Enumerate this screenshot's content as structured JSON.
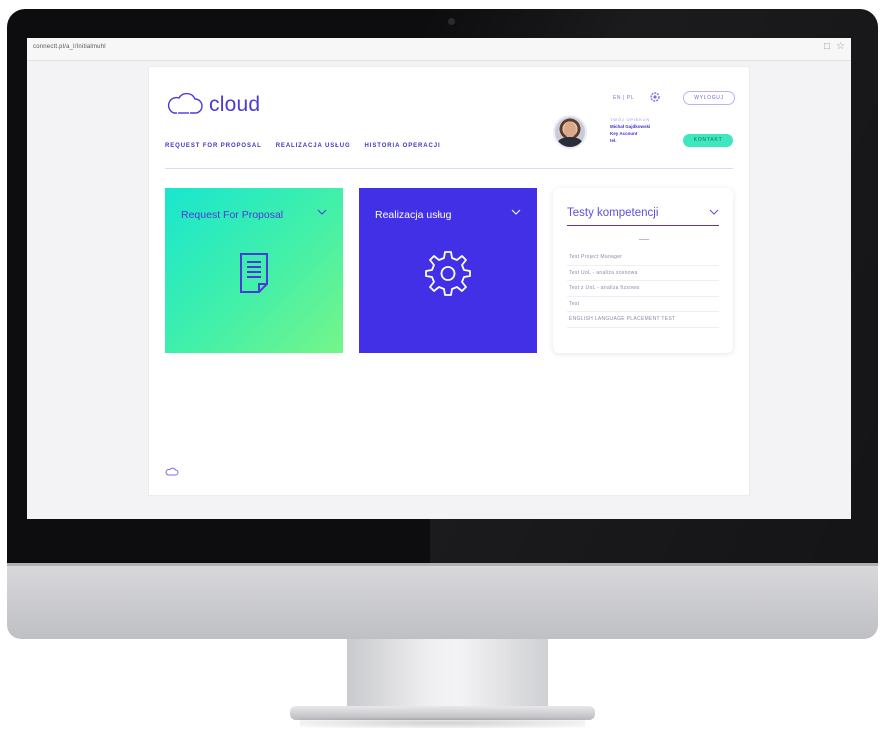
{
  "browser": {
    "url": "connectt.pl/a_l/Initialmuhl"
  },
  "app": {
    "logo_text": "cloud",
    "nav": [
      {
        "label": "REQUEST FOR PROPOSAL"
      },
      {
        "label": "REALIZACJA USŁUG"
      },
      {
        "label": "HISTORIA OPERACJI"
      }
    ],
    "header": {
      "lang": "EN | PL",
      "logout_label": "WYLOGUJ",
      "contact_label": "KONTAKT",
      "user": {
        "role": "TWÓJ OPIEKUN",
        "name": "Michał Gajdkowski",
        "title": "Key Account",
        "extra": "tel."
      }
    },
    "tiles": [
      {
        "title": "Request For Proposal",
        "icon": "document-icon"
      },
      {
        "title": "Realizacja usług",
        "icon": "gear-icon"
      }
    ],
    "tests": {
      "title": "Testy kompetencji",
      "items": [
        "Test Project Manager",
        "Test UoL - analiza scenowa",
        "Test z UoL - analiza fizsowa",
        "Test",
        "ENGLISH LANGUAGE PLACEMENT TEST"
      ]
    }
  },
  "colors": {
    "brand_purple": "#4130e6",
    "brand_teal": "#19e6cf",
    "brand_green": "#43f0a8",
    "contact_green": "#3ee7be"
  }
}
